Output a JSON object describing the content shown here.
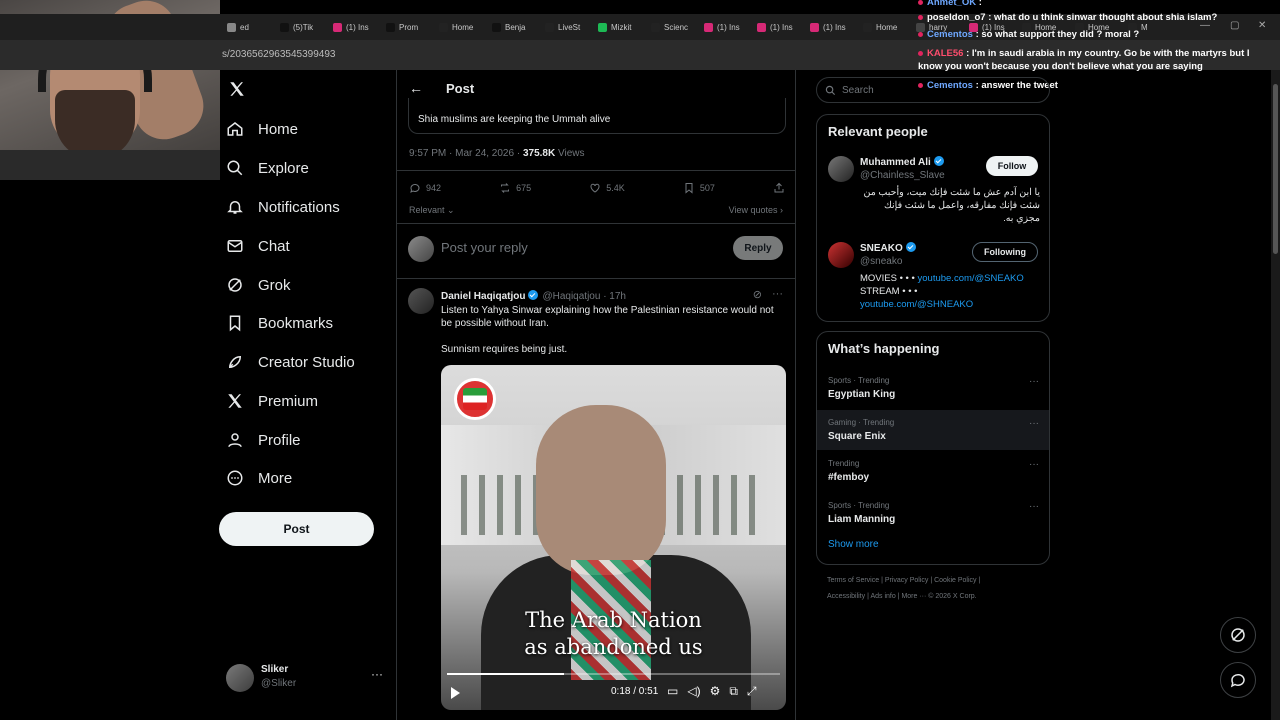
{
  "browser": {
    "url": "s/2036562963545399493",
    "tabs": [
      {
        "label": "ed",
        "color": "#888"
      },
      {
        "label": "(5)Tik",
        "color": "#111"
      },
      {
        "label": "(1) Ins",
        "color": "#d62976"
      },
      {
        "label": "Prom",
        "color": "#111"
      },
      {
        "label": "Home",
        "color": "#222"
      },
      {
        "label": "Benja",
        "color": "#111"
      },
      {
        "label": "LiveSt",
        "color": "#222"
      },
      {
        "label": "Mizkit",
        "color": "#1db954"
      },
      {
        "label": "Scienc",
        "color": "#222"
      },
      {
        "label": "(1) Ins",
        "color": "#d62976"
      },
      {
        "label": "(1) Ins",
        "color": "#d62976"
      },
      {
        "label": "(1) Ins",
        "color": "#d62976"
      },
      {
        "label": "Home",
        "color": "#222"
      },
      {
        "label": "harry",
        "color": "#444"
      },
      {
        "label": "(1) Ins",
        "color": "#d62976"
      },
      {
        "label": "Home",
        "color": "#222"
      },
      {
        "label": "Home",
        "color": "#222"
      },
      {
        "label": "M",
        "color": "#222"
      }
    ]
  },
  "chat": {
    "line0_user": "Ahmet_OK",
    "line0_text": ":",
    "line1_user": "poseldon_o7",
    "line1_text": ": what do u think sinwar thought about shia islam?",
    "line2_user": "Cementos",
    "line2_text": ": so what support they did ? moral ?",
    "line3_user": "KALE56",
    "line3_text": ": I'm in saudi arabia in my country. Go be with the martyrs but I know you won't because you don't believe what you are saying",
    "line4_user": "Cementos",
    "line4_text": ": answer the tweet"
  },
  "nav": {
    "items": [
      {
        "label": "Home",
        "icon": "home-icon"
      },
      {
        "label": "Explore",
        "icon": "search-icon"
      },
      {
        "label": "Notifications",
        "icon": "bell-icon"
      },
      {
        "label": "Chat",
        "icon": "mail-icon"
      },
      {
        "label": "Grok",
        "icon": "grok-icon"
      },
      {
        "label": "Bookmarks",
        "icon": "bookmark-icon"
      },
      {
        "label": "Creator Studio",
        "icon": "rocket-icon"
      },
      {
        "label": "Premium",
        "icon": "x-icon"
      },
      {
        "label": "Profile",
        "icon": "person-icon"
      },
      {
        "label": "More",
        "icon": "more-icon"
      }
    ],
    "post_label": "Post",
    "account": {
      "name": "Sliker",
      "handle": "@Sliker"
    }
  },
  "post": {
    "title": "Post",
    "quoted_text": "Shia muslims are keeping the Ummah alive",
    "timestamp": "9:57 PM · Mar 24, 2026 · ",
    "views_count": "375.8K",
    "views_label": " Views",
    "replies": "942",
    "reposts": "675",
    "likes": "5.4K",
    "bookmarks": "507",
    "sort_label": "Relevant",
    "view_quotes": "View quotes",
    "reply_placeholder": "Post your reply",
    "reply_button": "Reply"
  },
  "reply_tweet": {
    "name": "Daniel Haqiqatjou",
    "handle": "@Haqiqatjou · 17h",
    "text": "Listen to Yahya Sinwar explaining how the Palestinian resistance would not be possible without Iran.",
    "text2": "Sunnism requires being just.",
    "video_caption_1": "The Arab Nation",
    "video_caption_2": "as abandoned us",
    "video_time": "0:18 / 0:51",
    "video_progress": 0.35
  },
  "sidebar": {
    "search_placeholder": "Search",
    "relevant_title": "Relevant people",
    "people": [
      {
        "name": "Muhammed Ali",
        "handle": "@Chainless_Slave",
        "button": "Follow",
        "bio": "يا ابن آدم عش ما شئت فإنك ميت، وأحبب من شئت فإنك مفارقه، واعمل ما شئت فإنك مجزي به."
      },
      {
        "name": "SNEAKO",
        "handle": "@sneako",
        "button": "Following",
        "bio_1": "MOVIES • • • ",
        "bio_1_link": "youtube.com/@SNEAKO",
        "bio_2": "STREAM • • •",
        "bio_2_link": "youtube.com/@SHNEAKO"
      }
    ],
    "happening_title": "What’s happening",
    "trends": [
      {
        "category": "Sports · Trending",
        "title": "Egyptian King"
      },
      {
        "category": "Gaming · Trending",
        "title": "Square Enix"
      },
      {
        "category": "Trending",
        "title": "#femboy"
      },
      {
        "category": "Sports · Trending",
        "title": "Liam Manning"
      }
    ],
    "show_more": "Show more",
    "footer_1": "Terms of Service  |  Privacy Policy  |  Cookie Policy  |",
    "footer_2": "Accessibility  |  Ads info  |  More ···  © 2026 X Corp."
  }
}
